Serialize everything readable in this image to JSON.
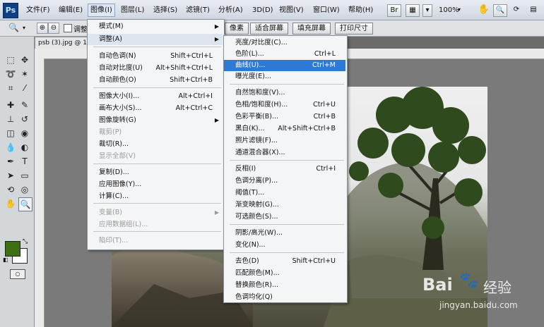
{
  "app": {
    "logo": "Ps"
  },
  "menubar": {
    "items": [
      "文件(F)",
      "编辑(E)",
      "图像(I)",
      "图层(L)",
      "选择(S)",
      "滤镜(T)",
      "分析(A)",
      "3D(D)",
      "视图(V)",
      "窗口(W)",
      "帮助(H)"
    ],
    "zoom": "100%"
  },
  "optbar": {
    "checkbox_label": "调整",
    "buttons": [
      "像素",
      "适合屏幕",
      "填充屏幕",
      "打印尺寸"
    ]
  },
  "document": {
    "tab_title": "psb (3).jpg @ 100"
  },
  "image_menu": {
    "items": [
      {
        "label": "模式(M)",
        "shortcut": "",
        "submenu": true,
        "disabled": false
      },
      {
        "label": "调整(A)",
        "shortcut": "",
        "submenu": true,
        "disabled": false,
        "active": true
      },
      {
        "label": "自动色调(N)",
        "shortcut": "Shift+Ctrl+L",
        "disabled": false
      },
      {
        "label": "自动对比度(U)",
        "shortcut": "Alt+Shift+Ctrl+L",
        "disabled": false
      },
      {
        "label": "自动颜色(O)",
        "shortcut": "Shift+Ctrl+B",
        "disabled": false
      },
      {
        "label": "图像大小(I)...",
        "shortcut": "Alt+Ctrl+I",
        "disabled": false
      },
      {
        "label": "画布大小(S)...",
        "shortcut": "Alt+Ctrl+C",
        "disabled": false
      },
      {
        "label": "图像旋转(G)",
        "shortcut": "",
        "submenu": true,
        "disabled": false
      },
      {
        "label": "裁剪(P)",
        "shortcut": "",
        "disabled": true
      },
      {
        "label": "裁切(R)...",
        "shortcut": "",
        "disabled": false
      },
      {
        "label": "显示全部(V)",
        "shortcut": "",
        "disabled": true
      },
      {
        "label": "复制(D)...",
        "shortcut": "",
        "disabled": false
      },
      {
        "label": "应用图像(Y)...",
        "shortcut": "",
        "disabled": false
      },
      {
        "label": "计算(C)...",
        "shortcut": "",
        "disabled": false
      },
      {
        "label": "变量(B)",
        "shortcut": "",
        "submenu": true,
        "disabled": true
      },
      {
        "label": "应用数据组(L)...",
        "shortcut": "",
        "disabled": true
      },
      {
        "label": "陷印(T)...",
        "shortcut": "",
        "disabled": true
      }
    ]
  },
  "adjust_menu": {
    "items": [
      {
        "label": "亮度/对比度(C)...",
        "shortcut": ""
      },
      {
        "label": "色阶(L)...",
        "shortcut": "Ctrl+L"
      },
      {
        "label": "曲线(U)...",
        "shortcut": "Ctrl+M",
        "highlighted": true
      },
      {
        "label": "曝光度(E)...",
        "shortcut": ""
      },
      {
        "label": "自然饱和度(V)...",
        "shortcut": ""
      },
      {
        "label": "色相/饱和度(H)...",
        "shortcut": "Ctrl+U"
      },
      {
        "label": "色彩平衡(B)...",
        "shortcut": "Ctrl+B"
      },
      {
        "label": "黑白(K)...",
        "shortcut": "Alt+Shift+Ctrl+B"
      },
      {
        "label": "照片滤镜(F)...",
        "shortcut": ""
      },
      {
        "label": "通道混合器(X)...",
        "shortcut": ""
      },
      {
        "label": "反相(I)",
        "shortcut": "Ctrl+I"
      },
      {
        "label": "色调分离(P)...",
        "shortcut": ""
      },
      {
        "label": "阈值(T)...",
        "shortcut": ""
      },
      {
        "label": "渐变映射(G)...",
        "shortcut": ""
      },
      {
        "label": "可选颜色(S)...",
        "shortcut": ""
      },
      {
        "label": "阴影/高光(W)...",
        "shortcut": ""
      },
      {
        "label": "变化(N)...",
        "shortcut": ""
      },
      {
        "label": "去色(D)",
        "shortcut": "Shift+Ctrl+U"
      },
      {
        "label": "匹配颜色(M)...",
        "shortcut": ""
      },
      {
        "label": "替换颜色(R)...",
        "shortcut": ""
      },
      {
        "label": "色调均化(Q)",
        "shortcut": ""
      }
    ]
  },
  "watermark": {
    "brand": "Bai",
    "brand2": "经验",
    "url": "jingyan.baidu.com"
  },
  "colors": {
    "accent": "#2f79d6",
    "foreground": "#3c6e12",
    "background": "#ffffff"
  }
}
